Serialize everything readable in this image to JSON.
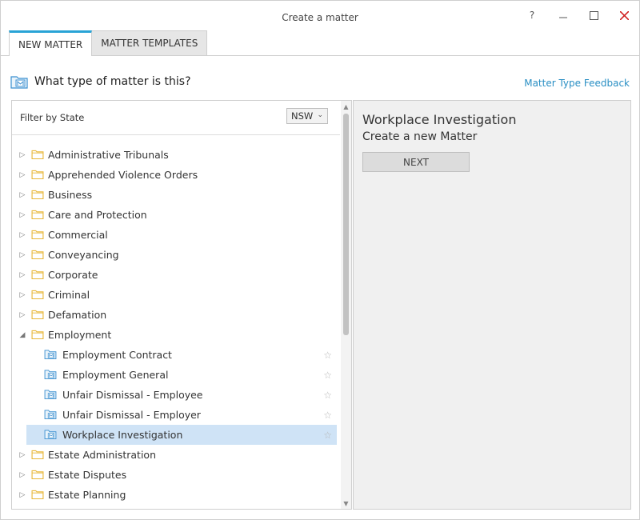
{
  "window": {
    "title": "Create a matter",
    "help": "?"
  },
  "tabs": [
    {
      "label": "NEW MATTER",
      "active": true
    },
    {
      "label": "MATTER TEMPLATES",
      "active": false
    }
  ],
  "header": {
    "question": "What type of matter is this?",
    "feedback_link": "Matter Type Feedback"
  },
  "filter": {
    "label": "Filter by State",
    "state": "NSW"
  },
  "tree": {
    "items": [
      {
        "label": "Administrative Tribunals",
        "type": "folder",
        "expanded": false
      },
      {
        "label": "Apprehended Violence Orders",
        "type": "folder",
        "expanded": false
      },
      {
        "label": "Business",
        "type": "folder",
        "expanded": false
      },
      {
        "label": "Care and Protection",
        "type": "folder",
        "expanded": false
      },
      {
        "label": "Commercial",
        "type": "folder",
        "expanded": false
      },
      {
        "label": "Conveyancing",
        "type": "folder",
        "expanded": false
      },
      {
        "label": "Corporate",
        "type": "folder",
        "expanded": false
      },
      {
        "label": "Criminal",
        "type": "folder",
        "expanded": false
      },
      {
        "label": "Defamation",
        "type": "folder",
        "expanded": false
      },
      {
        "label": "Employment",
        "type": "folder",
        "expanded": true
      },
      {
        "label": "Employment Contract",
        "type": "matter",
        "child": true
      },
      {
        "label": "Employment General",
        "type": "matter",
        "child": true
      },
      {
        "label": "Unfair Dismissal - Employee",
        "type": "matter",
        "child": true
      },
      {
        "label": "Unfair Dismissal - Employer",
        "type": "matter",
        "child": true
      },
      {
        "label": "Workplace Investigation",
        "type": "matter",
        "child": true,
        "selected": true
      },
      {
        "label": "Estate Administration",
        "type": "folder",
        "expanded": false
      },
      {
        "label": "Estate Disputes",
        "type": "folder",
        "expanded": false
      },
      {
        "label": "Estate Planning",
        "type": "folder",
        "expanded": false
      }
    ]
  },
  "detail": {
    "title": "Workplace Investigation",
    "subtitle": "Create a new Matter",
    "next_label": "NEXT"
  },
  "colors": {
    "accent": "#29a3d6",
    "selected": "#cfe3f6",
    "folder": "#e8b73a",
    "link": "#2a8fc4"
  }
}
